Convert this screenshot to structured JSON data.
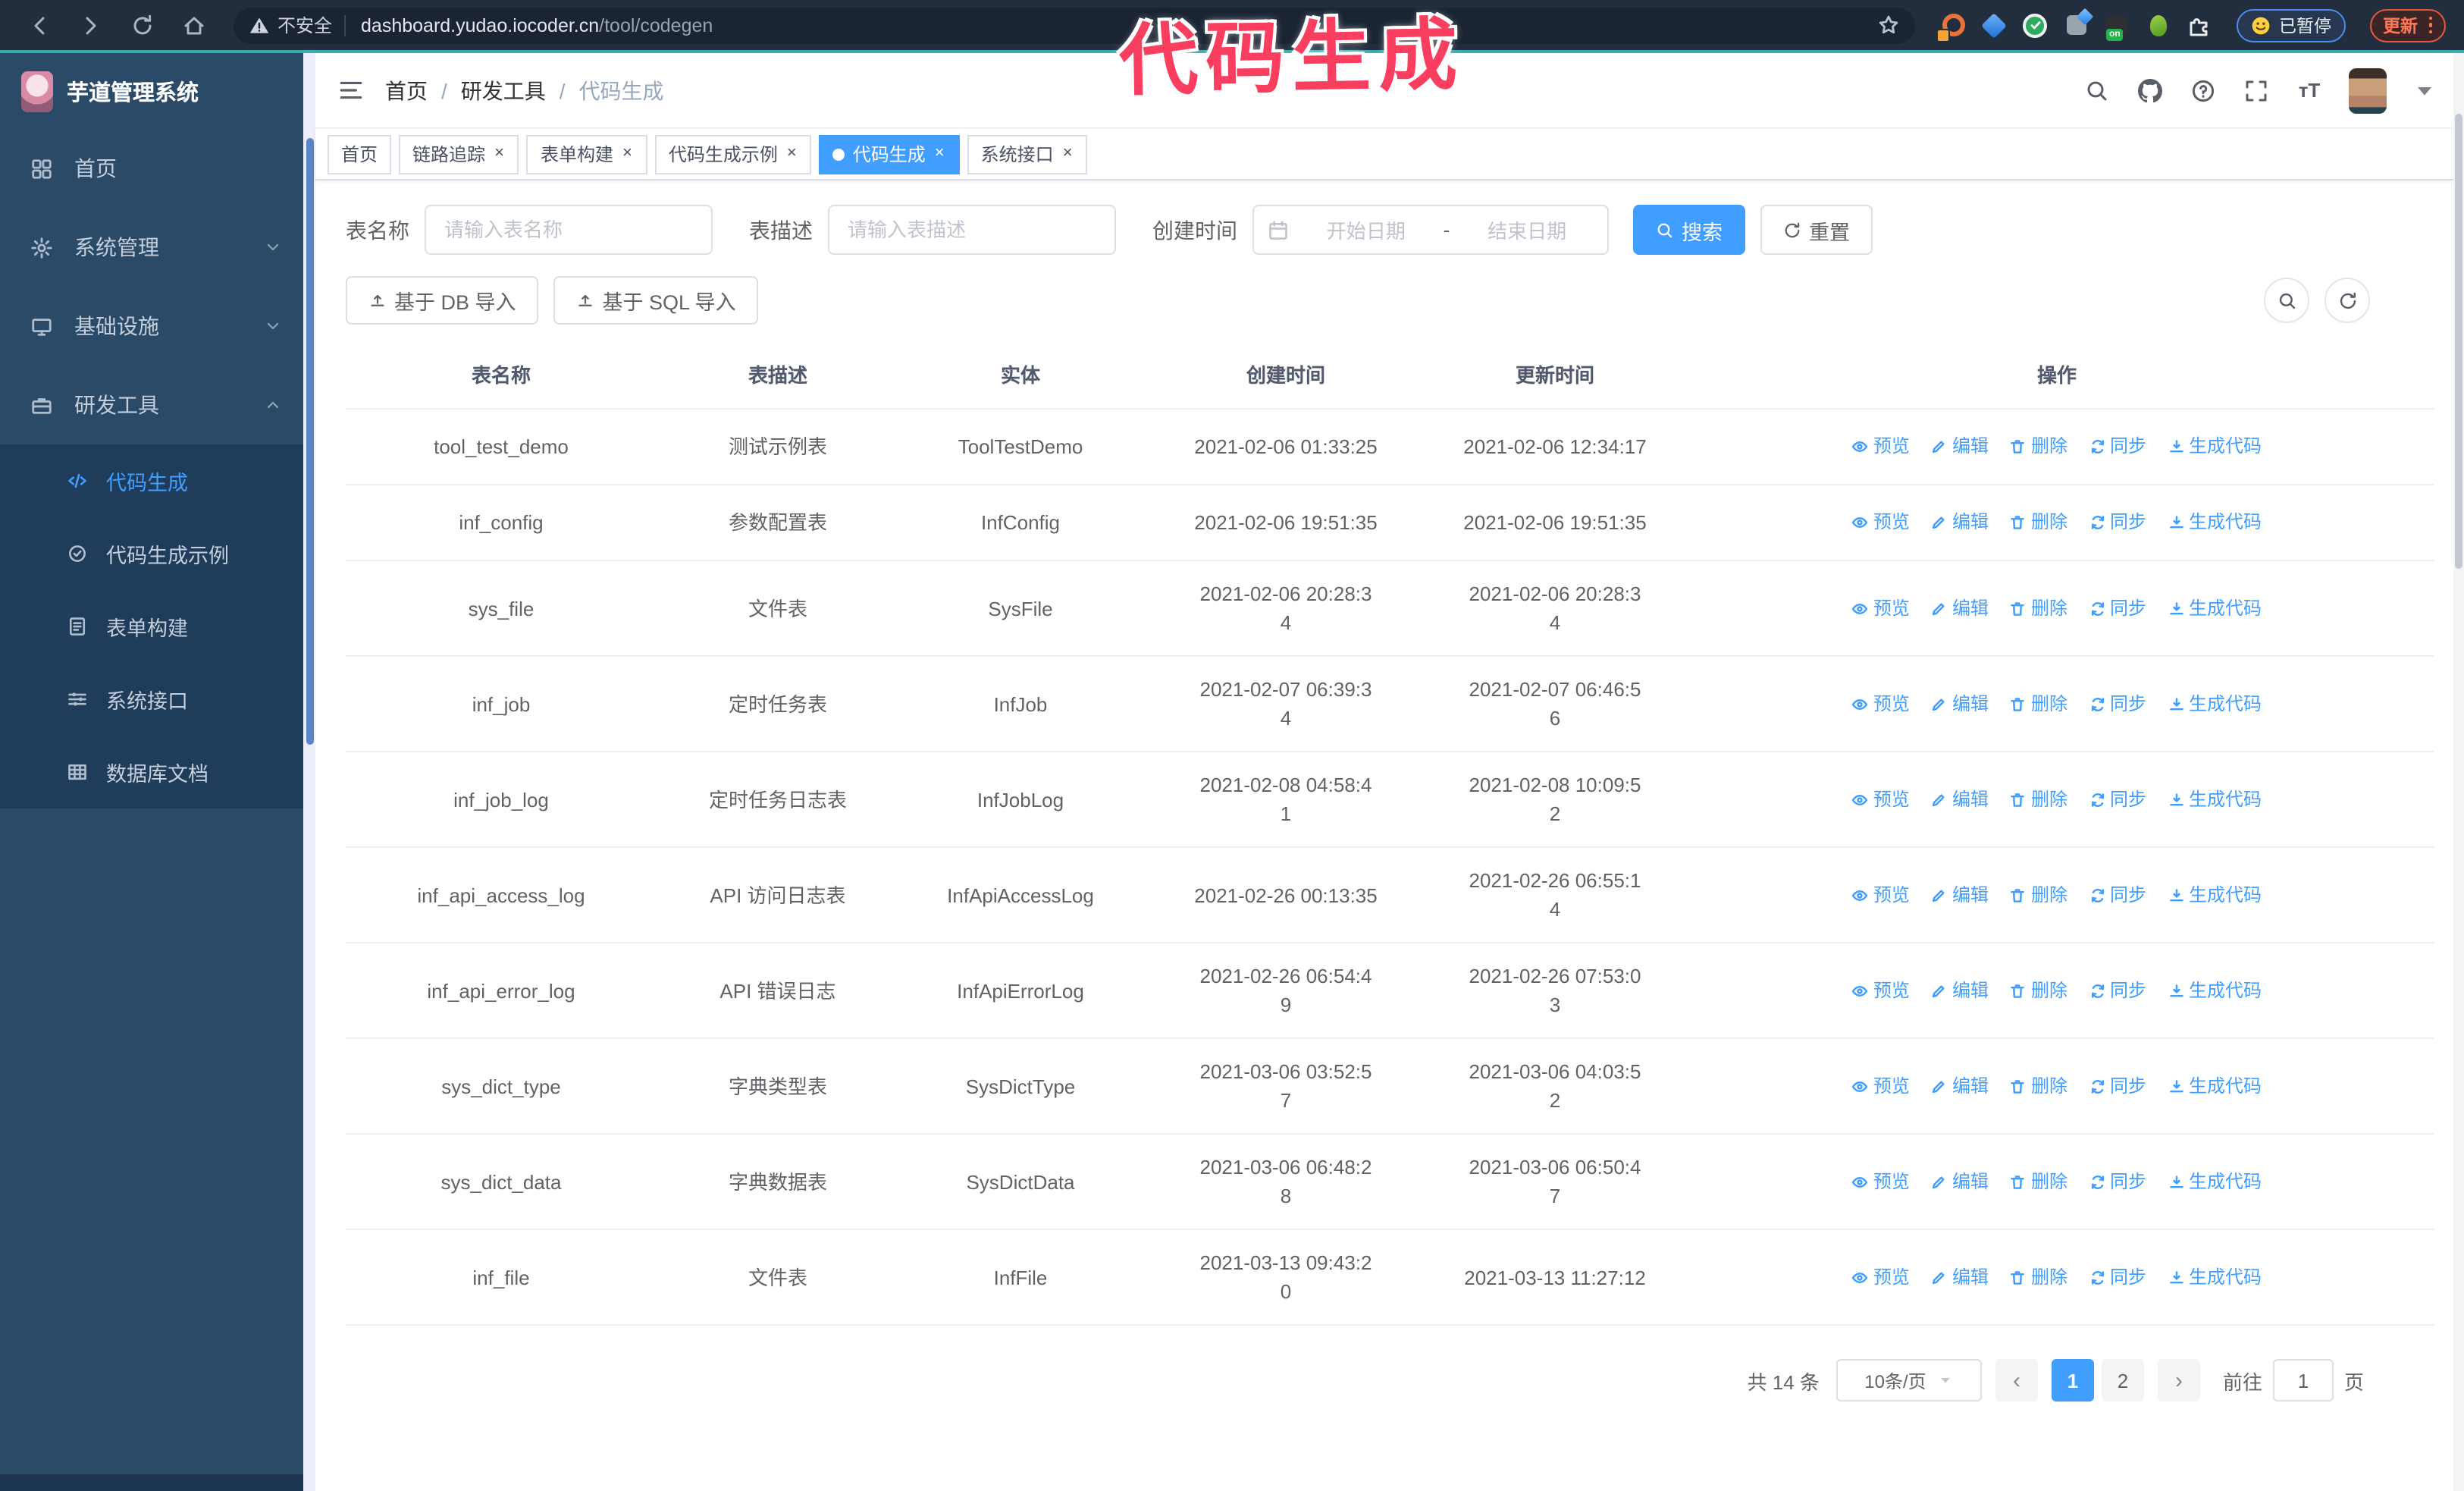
{
  "colors": {
    "accent": "#409eff",
    "annotation": "#fa3e60",
    "sidebar": "#2b4a67",
    "submenu": "#1f3c5b",
    "chrome": "#222d3d"
  },
  "annotation": "代码生成",
  "browser": {
    "security_label": "不安全",
    "url_domain": "dashboard.yudao.iocoder.cn",
    "url_path": "/tool/codegen",
    "paused_badge": "已暂停",
    "update_button": "更新",
    "extension_on_badge": "on"
  },
  "app": {
    "title": "芋道管理系统"
  },
  "breadcrumb": {
    "separator": "/",
    "items": [
      "首页",
      "研发工具",
      "代码生成"
    ]
  },
  "tabs": [
    {
      "label": "首页",
      "closable": false,
      "active": false
    },
    {
      "label": "链路追踪",
      "closable": true,
      "active": false
    },
    {
      "label": "表单构建",
      "closable": true,
      "active": false
    },
    {
      "label": "代码生成示例",
      "closable": true,
      "active": false
    },
    {
      "label": "代码生成",
      "closable": true,
      "active": true
    },
    {
      "label": "系统接口",
      "closable": true,
      "active": false
    }
  ],
  "sidebar": {
    "menu": [
      {
        "label": "首页",
        "icon": "dashboard-icon",
        "chevron": null,
        "children": null,
        "active": false
      },
      {
        "label": "系统管理",
        "icon": "gear-icon",
        "chevron": "down",
        "children": null,
        "active": false
      },
      {
        "label": "基础设施",
        "icon": "monitor-icon",
        "chevron": "down",
        "children": null,
        "active": false
      },
      {
        "label": "研发工具",
        "icon": "toolbox-icon",
        "chevron": "up",
        "active": false,
        "children": [
          {
            "label": "代码生成",
            "icon": "code-icon",
            "active": true
          },
          {
            "label": "代码生成示例",
            "icon": "badge-check-icon",
            "active": false
          },
          {
            "label": "表单构建",
            "icon": "form-icon",
            "active": false
          },
          {
            "label": "系统接口",
            "icon": "sliders-icon",
            "active": false
          },
          {
            "label": "数据库文档",
            "icon": "table-grid-icon",
            "active": false
          }
        ]
      }
    ]
  },
  "search_form": {
    "name_label": "表名称",
    "name_placeholder": "请输入表名称",
    "desc_label": "表描述",
    "desc_placeholder": "请输入表描述",
    "time_label": "创建时间",
    "start_placeholder": "开始日期",
    "range_separator": "-",
    "end_placeholder": "结束日期",
    "search_button": "搜索",
    "reset_button": "重置"
  },
  "toolbar": {
    "db_import": "基于 DB 导入",
    "sql_import": "基于 SQL 导入"
  },
  "table": {
    "headers": [
      "表名称",
      "表描述",
      "实体",
      "创建时间",
      "更新时间",
      "操作"
    ],
    "action_labels": [
      "预览",
      "编辑",
      "删除",
      "同步",
      "生成代码"
    ],
    "action_icons": [
      "eye-icon",
      "edit-icon",
      "trash-icon",
      "sync-icon",
      "download-icon"
    ],
    "rows": [
      {
        "name": "tool_test_demo",
        "desc": "测试示例表",
        "entity": "ToolTestDemo",
        "created": "2021-02-06 01:33:25",
        "updated": "2021-02-06 12:34:17"
      },
      {
        "name": "inf_config",
        "desc": "参数配置表",
        "entity": "InfConfig",
        "created": "2021-02-06 19:51:35",
        "updated": "2021-02-06 19:51:35"
      },
      {
        "name": "sys_file",
        "desc": "文件表",
        "entity": "SysFile",
        "created": "2021-02-06 20:28:3\n4",
        "updated": "2021-02-06 20:28:3\n4"
      },
      {
        "name": "inf_job",
        "desc": "定时任务表",
        "entity": "InfJob",
        "created": "2021-02-07 06:39:3\n4",
        "updated": "2021-02-07 06:46:5\n6"
      },
      {
        "name": "inf_job_log",
        "desc": "定时任务日志表",
        "entity": "InfJobLog",
        "created": "2021-02-08 04:58:4\n1",
        "updated": "2021-02-08 10:09:5\n2"
      },
      {
        "name": "inf_api_access_log",
        "desc": "API 访问日志表",
        "entity": "InfApiAccessLog",
        "created": "2021-02-26 00:13:35",
        "updated": "2021-02-26 06:55:1\n4"
      },
      {
        "name": "inf_api_error_log",
        "desc": "API 错误日志",
        "entity": "InfApiErrorLog",
        "created": "2021-02-26 06:54:4\n9",
        "updated": "2021-02-26 07:53:0\n3"
      },
      {
        "name": "sys_dict_type",
        "desc": "字典类型表",
        "entity": "SysDictType",
        "created": "2021-03-06 03:52:5\n7",
        "updated": "2021-03-06 04:03:5\n2"
      },
      {
        "name": "sys_dict_data",
        "desc": "字典数据表",
        "entity": "SysDictData",
        "created": "2021-03-06 06:48:2\n8",
        "updated": "2021-03-06 06:50:4\n7"
      },
      {
        "name": "inf_file",
        "desc": "文件表",
        "entity": "InfFile",
        "created": "2021-03-13 09:43:2\n0",
        "updated": "2021-03-13 11:27:12"
      }
    ]
  },
  "pagination": {
    "total": "共 14 条",
    "page_size": "10条/页",
    "pages": [
      "1",
      "2"
    ],
    "active_page": "1",
    "goto_label": "前往",
    "goto_value": "1",
    "goto_suffix": "页"
  }
}
